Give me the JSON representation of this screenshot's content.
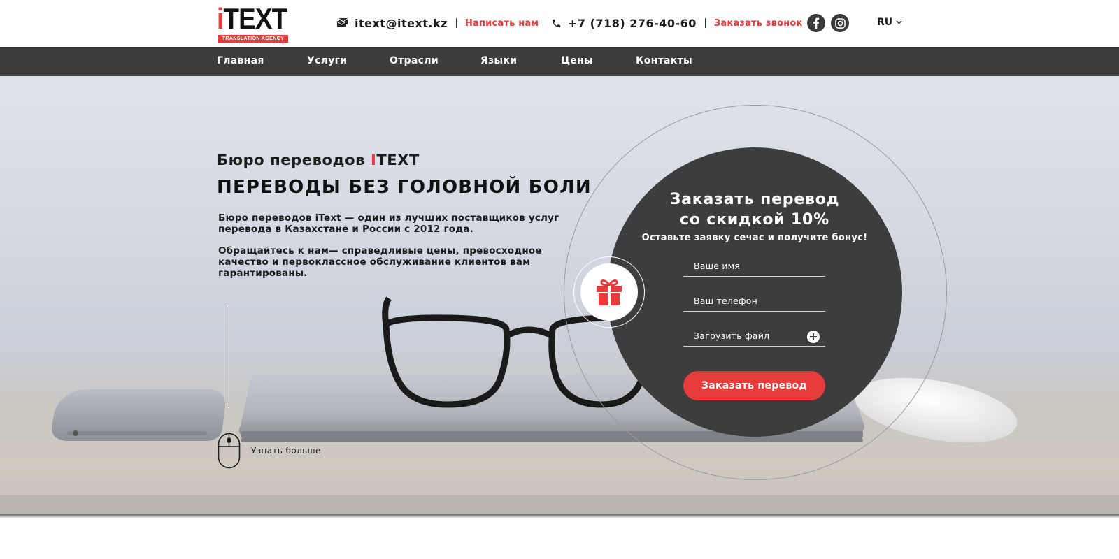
{
  "logo": {
    "word_i": "i",
    "word_rest": "TEXT",
    "tagline": "TRANSLATION AGENCY"
  },
  "header": {
    "email": {
      "icon": "envelope-icon",
      "address": "itext@itext.kz",
      "action": "Написать нам"
    },
    "phone": {
      "icon": "phone-icon",
      "number": "+7 (718) 276-40-60",
      "action": "Заказать звонок"
    },
    "social": [
      {
        "icon": "facebook-icon"
      },
      {
        "icon": "instagram-icon"
      }
    ],
    "language": "RU"
  },
  "nav": [
    "Главная",
    "Услуги",
    "Отрасли",
    "Языки",
    "Цены",
    "Контакты"
  ],
  "hero": {
    "subtitle_prefix": "Бюро переводов ",
    "subtitle_accent": "I",
    "subtitle_rest": "TEXT",
    "headline": "ПЕРЕВОДЫ БЕЗ ГОЛОВНОЙ БОЛИ",
    "paragraph_1": "Бюро переводов iText — один из лучших поставщиков услуг перевода в Казахстане и России с 2012 года.",
    "paragraph_2": "Обращайтесь к нам— справедливые цены, превосходное качество и первоклассное обслуживание клиентов вам гарантированы.",
    "learn_more": "Узнать больше"
  },
  "form": {
    "title_line_1": "Заказать перевод",
    "title_line_2": "со скидкой 10%",
    "subtitle": "Оставьте заявку сечас и получите бонус!",
    "name_placeholder": "Ваше имя",
    "phone_placeholder": "Ваш телефон",
    "file_placeholder": "Загрузить файл",
    "submit": "Заказать перевод"
  },
  "colors": {
    "accent": "#e63c3c",
    "nav_bg": "#3c3c3c",
    "circle_bg": "#3d3d3d"
  }
}
